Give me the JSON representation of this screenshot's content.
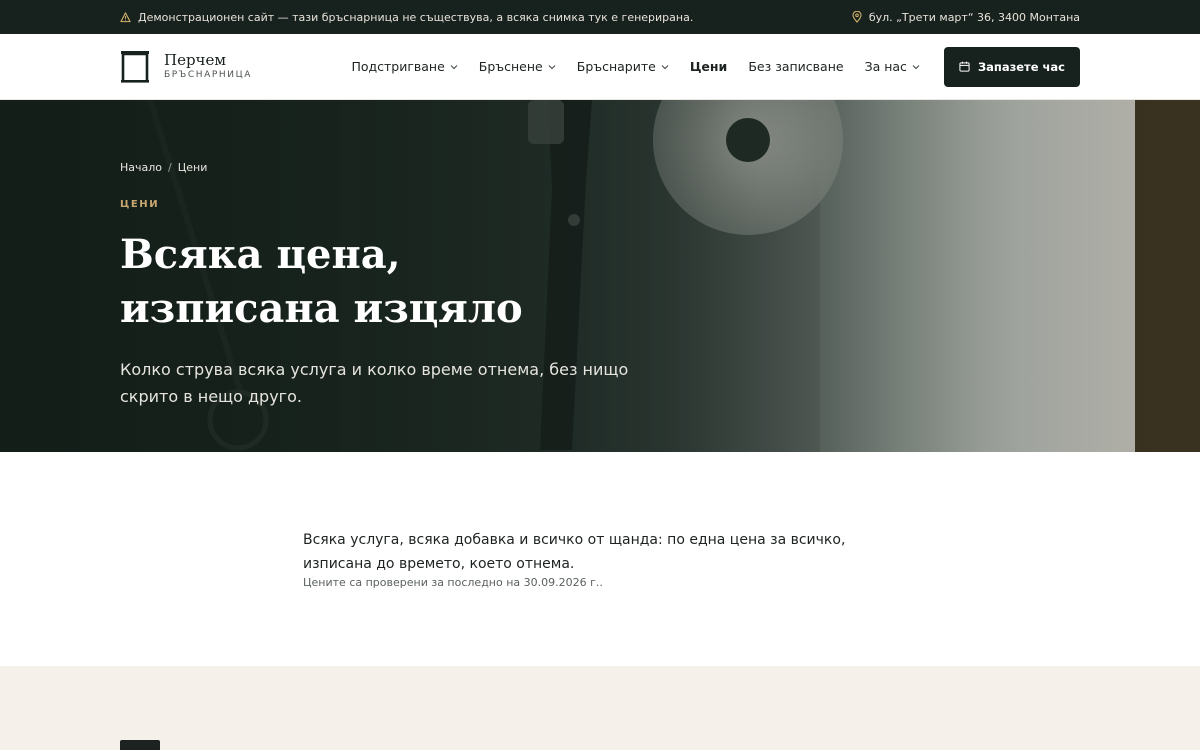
{
  "topbar": {
    "notice": "Демонстрационен сайт — тази бръснарница не съществува, а всяка снимка тук е генерирана.",
    "notice_icon": "warning-icon",
    "address": "бул. „Трети март“ 36, 3400 Монтана",
    "address_icon": "map-pin-icon"
  },
  "brand": {
    "name": "Перчем",
    "subtitle": "БРЪСНАРНИЦА"
  },
  "nav": {
    "items": [
      {
        "label": "Подстригване"
      },
      {
        "label": "Бръснене"
      },
      {
        "label": "Бръснарите"
      },
      {
        "label": "Цени"
      },
      {
        "label": "Без записване"
      },
      {
        "label": "За нас"
      }
    ],
    "cta_label": "Запазете час",
    "cta_icon": "calendar-icon"
  },
  "hero": {
    "breadcrumb": {
      "home": "Начало",
      "separator": "/",
      "current": "Цени"
    },
    "eyebrow": "ЦЕНИ",
    "title_line1": "Всяка цена,",
    "title_line2": "изписана изцяло",
    "lead": "Колко струва всяка услуга и колко време отнема, без нищо скрито в нещо друго."
  },
  "intro": {
    "text": "Всяка услуга, всяка добавка и всичко от щанда: по една цена за всичко, изписана до времето, което отнема.",
    "note": "Цените са проверени за последно на 30.09.2026 г.."
  },
  "colors": {
    "dark": "#17211d",
    "accent": "#c9a770",
    "beige": "#f5f1ea"
  }
}
